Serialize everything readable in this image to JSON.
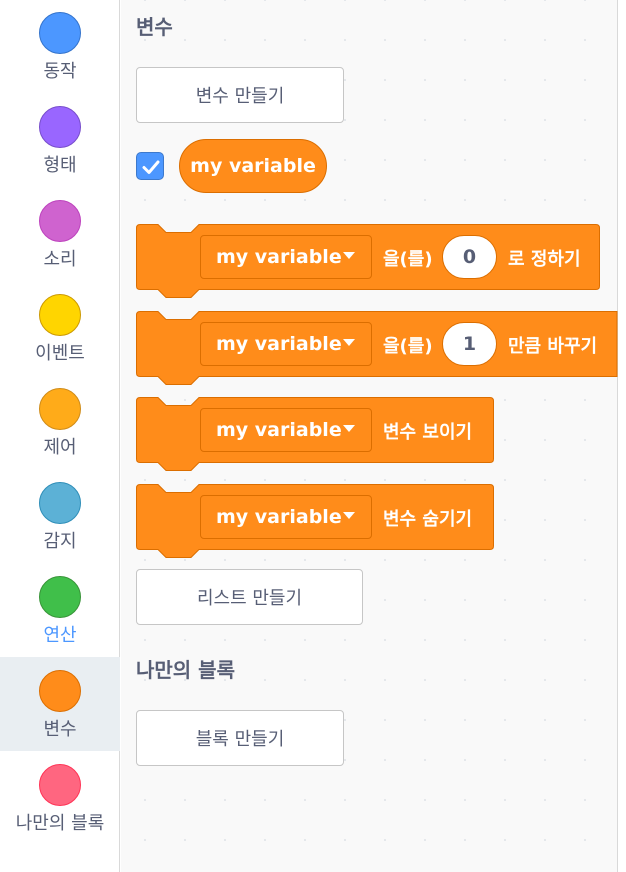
{
  "categories": [
    {
      "label": "동작",
      "color": "#4c97ff"
    },
    {
      "label": "형태",
      "color": "#9966ff"
    },
    {
      "label": "소리",
      "color": "#cf63cf"
    },
    {
      "label": "이벤트",
      "color": "#ffd500"
    },
    {
      "label": "제어",
      "color": "#ffab19"
    },
    {
      "label": "감지",
      "color": "#5cb1d6"
    },
    {
      "label": "연산",
      "color": "#40bf4a"
    },
    {
      "label": "변수",
      "color": "#ff8c1a"
    },
    {
      "label": "나만의 블록",
      "color": "#ff6680"
    }
  ],
  "selected_category": "변수",
  "variables_section": {
    "title": "변수",
    "make_variable_label": "변수 만들기",
    "variable_name": "my variable",
    "variable_checked": true,
    "blocks": {
      "set": {
        "variable": "my variable",
        "particle": "을(를)",
        "value": "0",
        "suffix": "로 정하기"
      },
      "change": {
        "variable": "my variable",
        "particle": "을(를)",
        "value": "1",
        "suffix": "만큼 바꾸기"
      },
      "show": {
        "variable": "my variable",
        "suffix": "변수 보이기"
      },
      "hide": {
        "variable": "my variable",
        "suffix": "변수 숨기기"
      }
    },
    "make_list_label": "리스트 만들기"
  },
  "my_blocks_section": {
    "title": "나만의 블록",
    "make_block_label": "블록 만들기"
  },
  "colors": {
    "variables_block": "#ff8c1a",
    "variables_block_border": "#db6e00",
    "checkbox": "#4c97ff"
  }
}
